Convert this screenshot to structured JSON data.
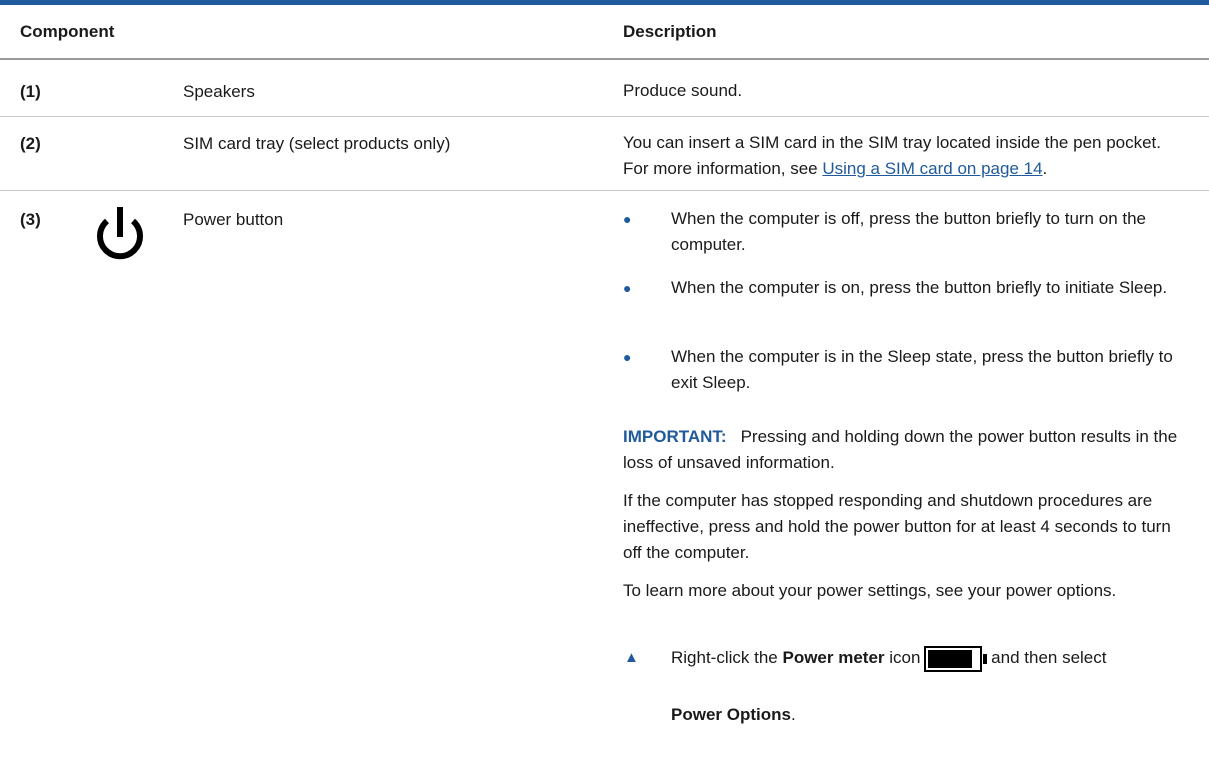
{
  "header": {
    "component": "Component",
    "description": "Description"
  },
  "rows": [
    {
      "num": "(1)",
      "name": "Speakers",
      "desc": "Produce sound."
    },
    {
      "num": "(2)",
      "name": "SIM card tray (select products only)",
      "desc_pre": "You can insert a SIM card in the SIM tray located inside the pen pocket. For more information, see ",
      "desc_link": "Using a SIM card on page 14",
      "desc_post": "."
    },
    {
      "num": "(3)",
      "name": "Power button",
      "icon": "power-icon",
      "bullets": [
        "When the computer is off, press the button briefly to turn on the computer.",
        "When the computer is on, press the button briefly to initiate Sleep.",
        "When the computer is in the Sleep state, press the button briefly to exit Sleep."
      ],
      "important_label": "IMPORTANT:",
      "important_text": "Pressing and holding down the power button results in the loss of unsaved information.",
      "para1": "If the computer has stopped responding and shutdown procedures are ineffective, press and hold the power button for at least 4 seconds to turn off the computer.",
      "para2": "To learn more about your power settings, see your power options.",
      "step_pre": "Right-click the ",
      "step_bold": "Power meter",
      "step_mid": " icon",
      "step_post": " and then select",
      "step_bold2": "Power Options",
      "step_end": "."
    }
  ],
  "colors": {
    "accent": "#1f5a9c",
    "rule": "#c8c8c8"
  }
}
